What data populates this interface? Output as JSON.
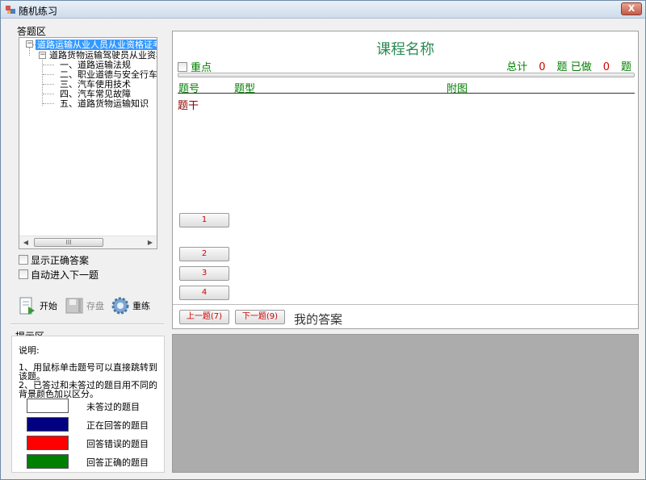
{
  "window": {
    "title": "随机练习",
    "close_label": "X"
  },
  "left": {
    "group_label": "答题区",
    "tree": {
      "root": "道路运输从业人员从业资格证考试",
      "child": "道路货物运输驾驶员从业资格",
      "items": [
        "一、道路运输法规",
        "二、职业道德与安全行车知",
        "三、汽车使用技术",
        "四、汽车常见故障",
        "五、道路货物运输知识"
      ],
      "scroll_thumb": "III"
    },
    "options": {
      "show_answer": "显示正确答案",
      "auto_next": "自动进入下一题"
    },
    "toolbar": {
      "start": "开始",
      "save": "存盘",
      "redo": "重练"
    }
  },
  "hint": {
    "group_label": "提示区",
    "heading": "说明:",
    "line1": "1、用鼠标单击题号可以直接跳转到该题。",
    "line2": "2、已答过和未答过的题目用不同的背景颜色加以区分。",
    "legend": [
      {
        "label": "未答过的题目",
        "color": "#ffffff"
      },
      {
        "label": "正在回答的题目",
        "color": "#000080"
      },
      {
        "label": "回答错误的题目",
        "color": "#ff0000"
      },
      {
        "label": "回答正确的题目",
        "color": "#008000"
      }
    ]
  },
  "main": {
    "course_title": "课程名称",
    "key_point": "重点",
    "stats": {
      "total_label": "总计",
      "total_value": "0",
      "unit1": "题",
      "done_label": "已做",
      "done_value": "0",
      "unit2": "题"
    },
    "columns": {
      "number": "题号",
      "type": "题型",
      "figure": "附图"
    },
    "stem_label": "题干",
    "options": [
      "1",
      "2",
      "3",
      "4"
    ],
    "nav": {
      "prev": "上一题(7)",
      "next": "下一题(9)",
      "my_answer": "我的答案"
    }
  }
}
